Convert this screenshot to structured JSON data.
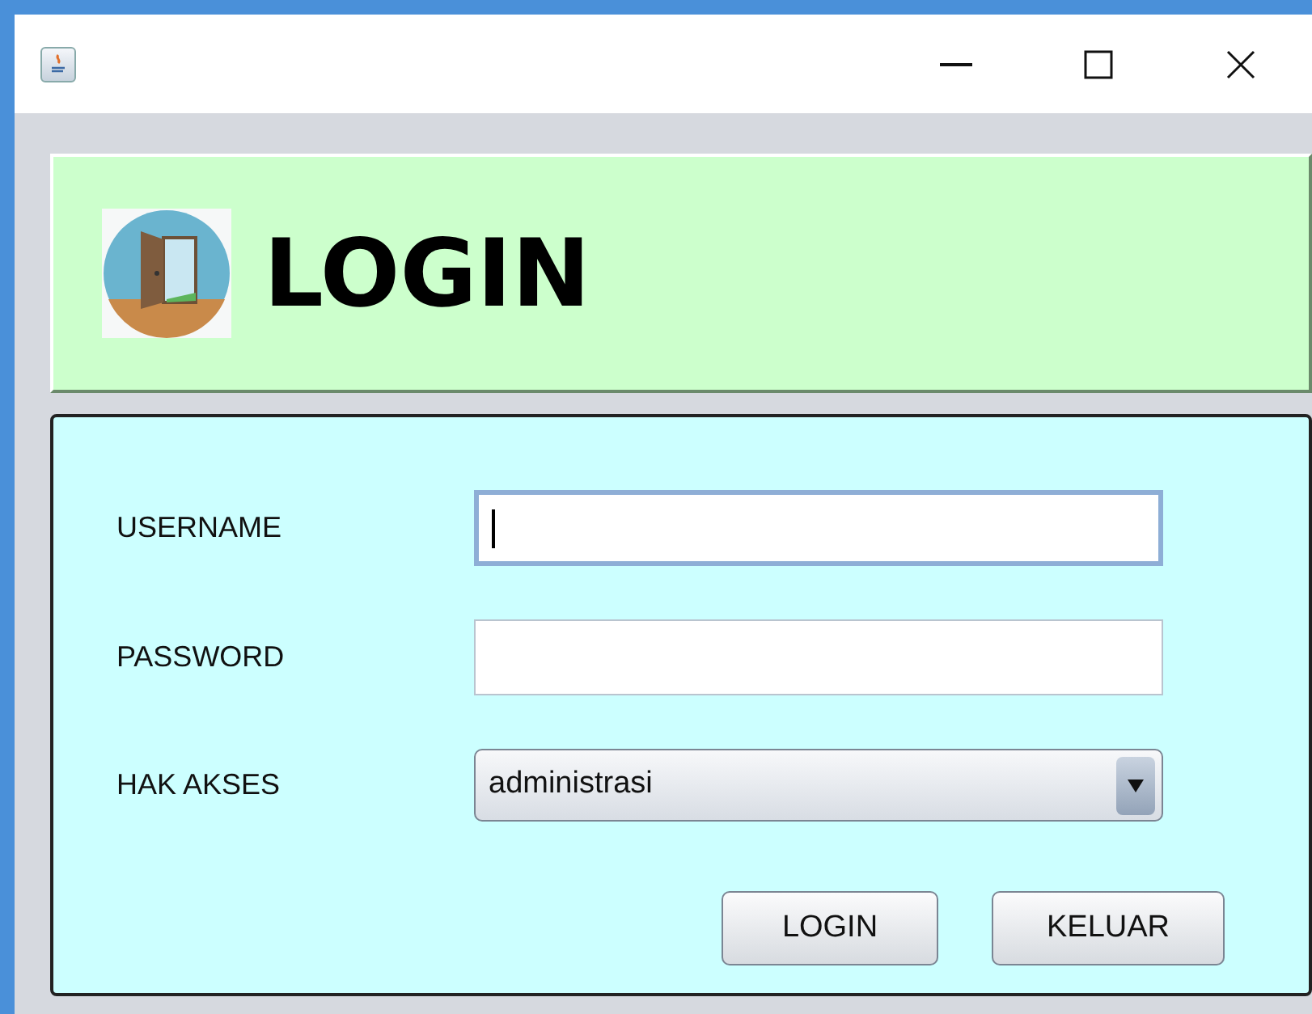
{
  "header": {
    "title": "LOGIN"
  },
  "form": {
    "fields": [
      {
        "kind": "text",
        "label": "USERNAME",
        "focused": true
      },
      {
        "kind": "text",
        "label": "PASSWORD",
        "focused": false
      },
      {
        "kind": "combo",
        "label": "HAK AKSES",
        "value": "administrasi",
        "focused": false
      }
    ],
    "buttons": [
      "LOGIN",
      "KELUAR"
    ]
  }
}
